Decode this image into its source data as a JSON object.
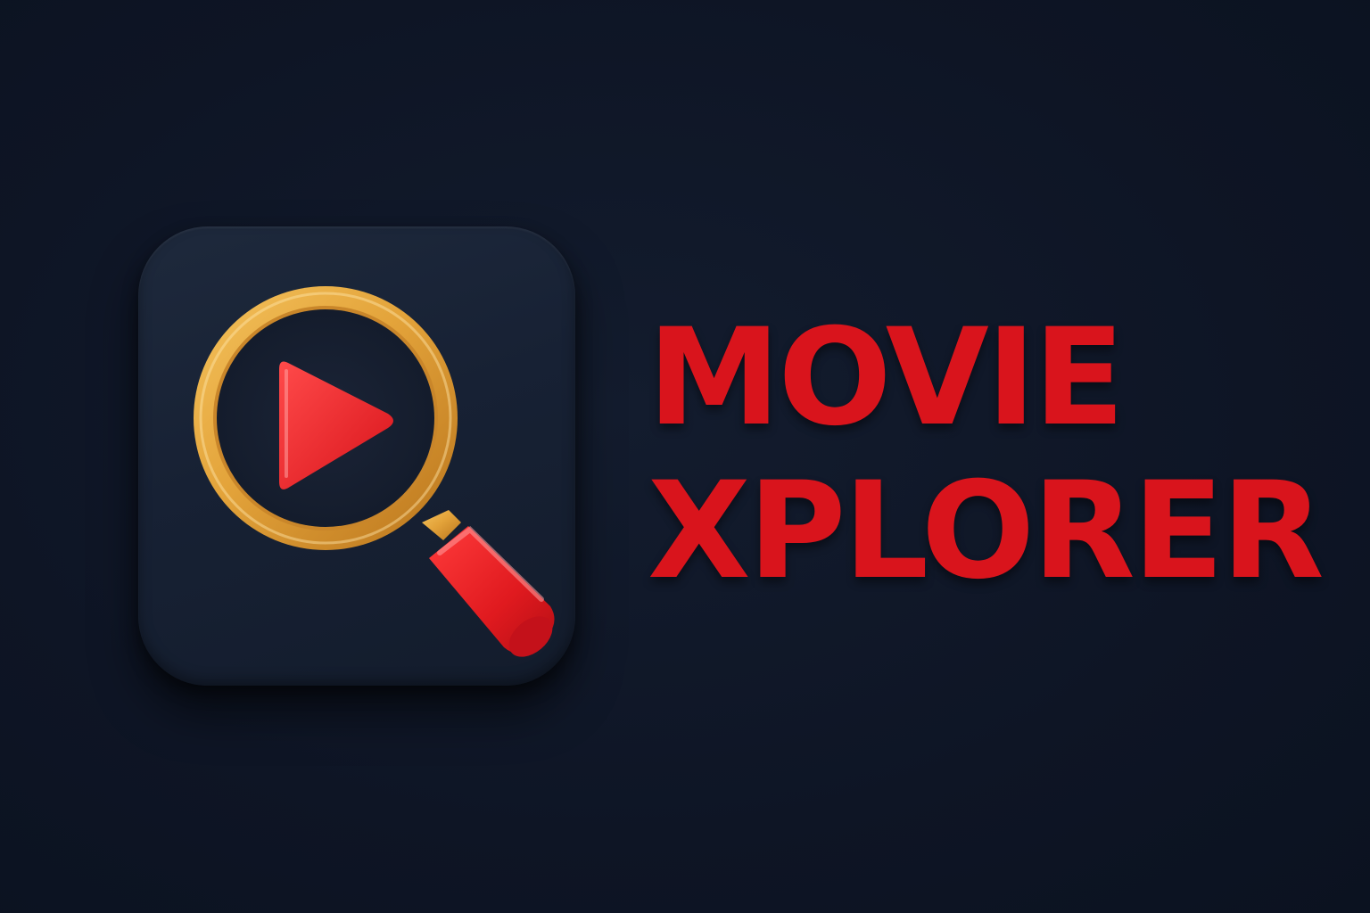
{
  "brand": {
    "title_line1": "MOVIE",
    "title_line2": "XPLORER",
    "icon": "magnifier-play-icon",
    "colors": {
      "background": "#0f1727",
      "icon_tile": "#172134",
      "accent_red": "#d9141c",
      "gold_ring": "#e3a33a"
    }
  }
}
